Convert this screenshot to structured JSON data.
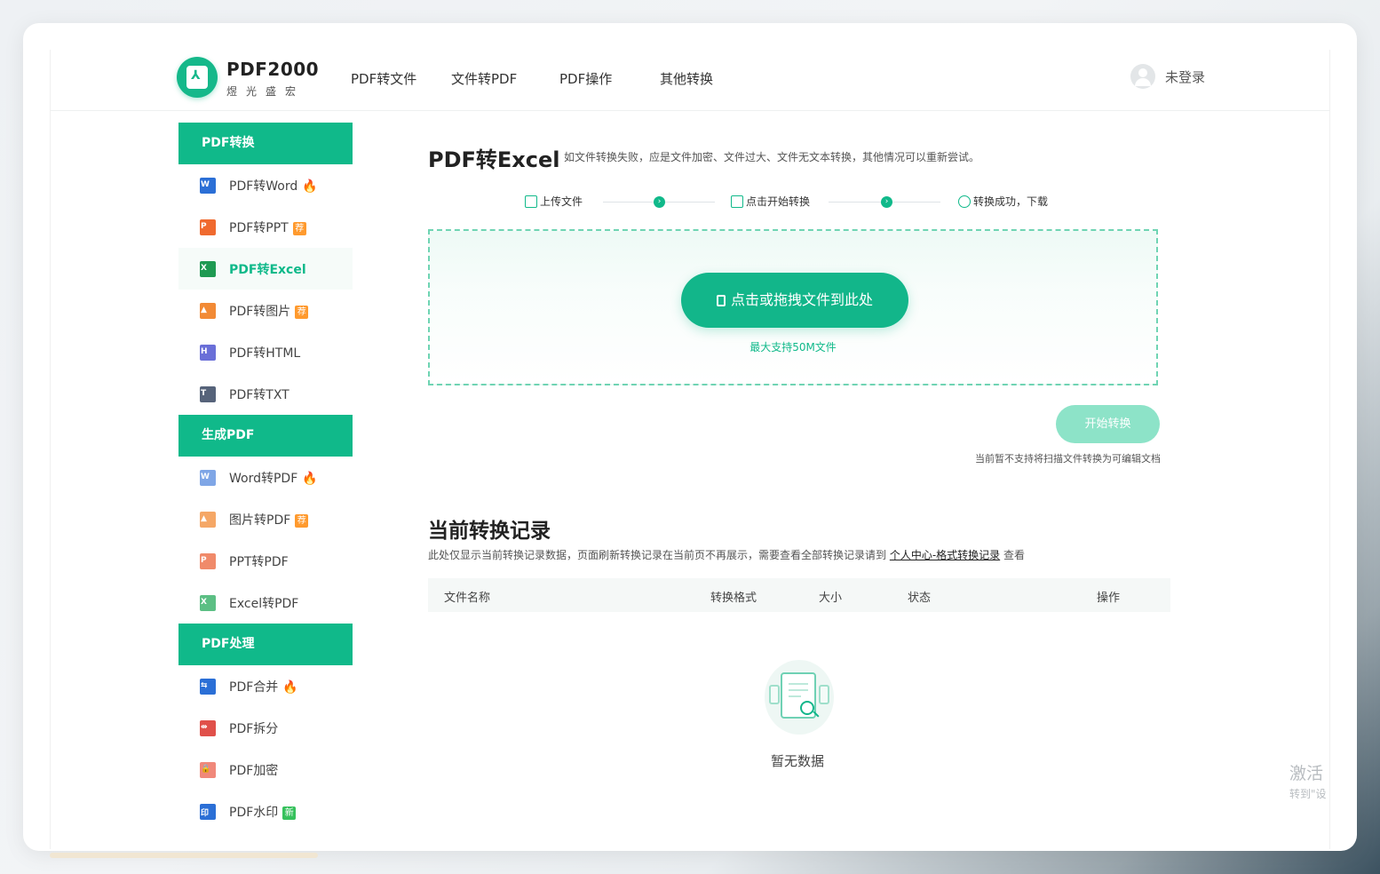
{
  "brand": {
    "name": "PDF2000",
    "subtitle": "煜光盛宏"
  },
  "nav": [
    "PDF转文件",
    "文件转PDF",
    "PDF操作",
    "其他转换"
  ],
  "user": {
    "label": "未登录"
  },
  "sidebar": {
    "sections": [
      {
        "title": "PDF转换",
        "items": [
          {
            "label": "PDF转Word",
            "icon": "word-file-icon",
            "glyph": "W",
            "color": "#2b6fd6",
            "badge": "fire"
          },
          {
            "label": "PDF转PPT",
            "icon": "ppt-file-icon",
            "glyph": "P",
            "color": "#f06a2f",
            "badge": "荐"
          },
          {
            "label": "PDF转Excel",
            "icon": "excel-file-icon",
            "glyph": "X",
            "color": "#1f9a52",
            "badge": "",
            "active": true
          },
          {
            "label": "PDF转图片",
            "icon": "image-file-icon",
            "glyph": "▲",
            "color": "#f28a35",
            "badge": "荐"
          },
          {
            "label": "PDF转HTML",
            "icon": "html-file-icon",
            "glyph": "H",
            "color": "#6a6fd8",
            "badge": ""
          },
          {
            "label": "PDF转TXT",
            "icon": "txt-file-icon",
            "glyph": "T",
            "color": "#56637a",
            "badge": ""
          }
        ]
      },
      {
        "title": "生成PDF",
        "items": [
          {
            "label": "Word转PDF",
            "icon": "word-to-pdf-icon",
            "glyph": "W",
            "color": "#7fa6e6",
            "badge": "fire"
          },
          {
            "label": "图片转PDF",
            "icon": "image-to-pdf-icon",
            "glyph": "▲",
            "color": "#f5a766",
            "badge": "荐"
          },
          {
            "label": "PPT转PDF",
            "icon": "ppt-to-pdf-icon",
            "glyph": "P",
            "color": "#f08a6a",
            "badge": ""
          },
          {
            "label": "Excel转PDF",
            "icon": "excel-to-pdf-icon",
            "glyph": "X",
            "color": "#5cbf84",
            "badge": ""
          }
        ]
      },
      {
        "title": "PDF处理",
        "items": [
          {
            "label": "PDF合并",
            "icon": "pdf-merge-icon",
            "glyph": "⇆",
            "color": "#2b6fd6",
            "badge": "fire"
          },
          {
            "label": "PDF拆分",
            "icon": "pdf-split-icon",
            "glyph": "⇹",
            "color": "#e0504a",
            "badge": ""
          },
          {
            "label": "PDF加密",
            "icon": "pdf-lock-icon",
            "glyph": "🔒",
            "color": "#f0887a",
            "badge": ""
          },
          {
            "label": "PDF水印",
            "icon": "pdf-watermark-icon",
            "glyph": "印",
            "color": "#2b6fd6",
            "badge": "新"
          }
        ]
      }
    ]
  },
  "main": {
    "title": "PDF转Excel",
    "note": "如文件转换失败，应是文件加密、文件过大、文件无文本转换，其他情况可以重新尝试。",
    "steps": [
      "上传文件",
      "点击开始转换",
      "转换成功，下载"
    ],
    "drop_button": "点击或拖拽文件到此处",
    "drop_note": "最大支持50M文件",
    "start_button": "开始转换",
    "start_note": "当前暂不支持将扫描文件转换为可编辑文档"
  },
  "records": {
    "title": "当前转换记录",
    "note_before": "此处仅显示当前转换记录数据，页面刷新转换记录在当前页不再展示，需要查看全部转换记录请到 ",
    "note_link": "个人中心-格式转换记录",
    "note_after": " 查看",
    "columns": [
      "文件名称",
      "转换格式",
      "大小",
      "状态",
      "操作"
    ],
    "empty_text": "暂无数据"
  },
  "watermark": {
    "line1": "激活",
    "line2": "转到\"设"
  }
}
